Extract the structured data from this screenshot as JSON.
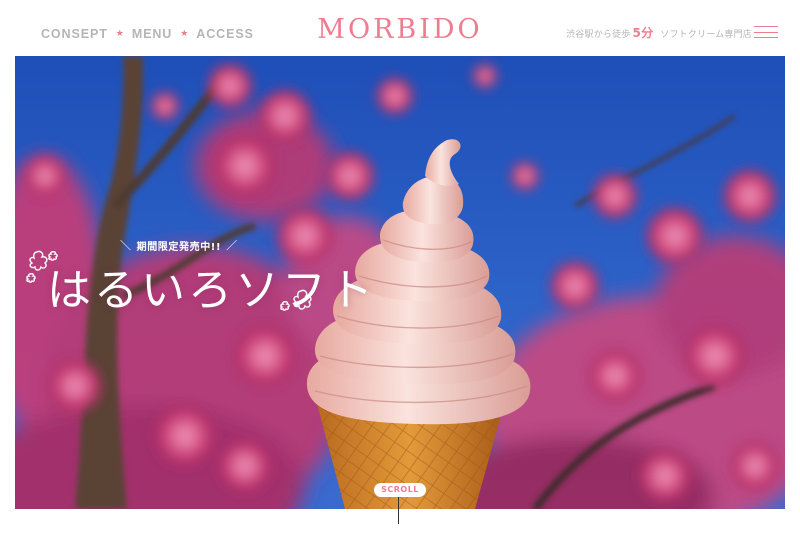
{
  "header": {
    "nav": [
      {
        "label": "CONSEPT"
      },
      {
        "label": "MENU"
      },
      {
        "label": "ACCESS"
      }
    ],
    "nav_separator": "★",
    "logo": "MORBIDO",
    "tagline": {
      "prefix": "渋谷駅から徒歩",
      "number": "5分",
      "shop": "ソフトクリーム専門店"
    },
    "menu_icon": "hamburger-icon"
  },
  "hero": {
    "limited_label": "期間限定発売中!!",
    "slash_left": "＼",
    "slash_right": "／",
    "title": "はるいろソフト",
    "decor_icons": [
      "flower-outline-icon"
    ]
  },
  "scroll": {
    "label": "SCROLL"
  },
  "colors": {
    "accent": "#ee7d91",
    "nav_text": "#b5b5b5",
    "sky": "#2a5cc4",
    "blossom": "#d24a80",
    "cone": "#d88a2c",
    "cream": "#f8d3cf"
  }
}
